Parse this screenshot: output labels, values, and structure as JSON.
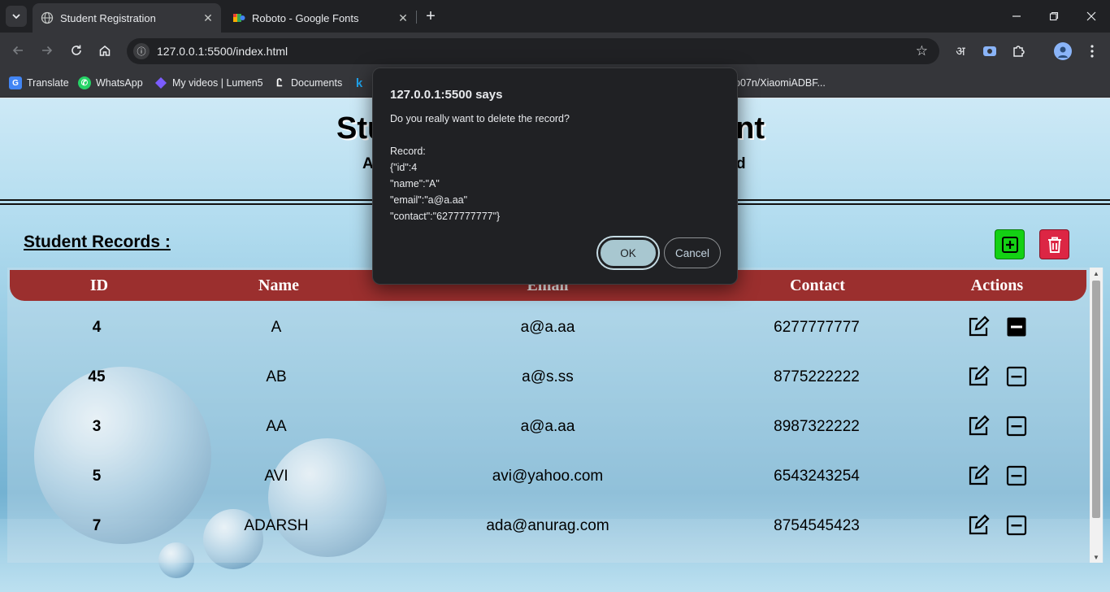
{
  "browser": {
    "tabs": [
      {
        "title": "Student Registration",
        "active": true,
        "icon": "globe-icon"
      },
      {
        "title": "Roboto - Google Fonts",
        "active": false,
        "icon": "google-fonts-icon"
      }
    ],
    "url": "127.0.0.1:5500/index.html",
    "bookmarks": [
      {
        "label": "Translate",
        "icon": "translate-icon",
        "color": "#4285f4"
      },
      {
        "label": "WhatsApp",
        "icon": "whatsapp-icon",
        "color": "#25d366"
      },
      {
        "label": "My videos | Lumen5",
        "icon": "lumen5-icon",
        "color": "#7b5cff"
      },
      {
        "label": "Documents",
        "icon": "documents-icon",
        "color": "#ffffff"
      },
      {
        "label": "",
        "icon": "k-icon",
        "color": "#1fa3ec"
      },
      {
        "label": "p07n/XiaomiADBF...",
        "icon": "",
        "color": ""
      }
    ],
    "extension_label": "अ"
  },
  "page": {
    "title_left": "Stu",
    "title_right": "ent",
    "subtitle_left": "A",
    "subtitle_right": "d",
    "records_title": "Student Records :",
    "columns": [
      "ID",
      "Name",
      "Email",
      "Contact",
      "Actions"
    ],
    "rows": [
      {
        "id": "4",
        "name": "A",
        "email": "a@a.aa",
        "contact": "6277777777"
      },
      {
        "id": "45",
        "name": "AB",
        "email": "a@s.ss",
        "contact": "8775222222"
      },
      {
        "id": "3",
        "name": "AA",
        "email": "a@a.aa",
        "contact": "8987322222"
      },
      {
        "id": "5",
        "name": "AVI",
        "email": "avi@yahoo.com",
        "contact": "6543243254"
      },
      {
        "id": "7",
        "name": "ADARSH",
        "email": "ada@anurag.com",
        "contact": "8754545423"
      }
    ],
    "colors": {
      "header": "#9b2f2e",
      "add": "#14d114",
      "delete": "#dc2644"
    }
  },
  "dialog": {
    "title": "127.0.0.1:5500 says",
    "message": "Do you really want to delete the record?",
    "record_label": "Record:",
    "record_lines": [
      "{\"id\":4",
      "\"name\":\"A\"",
      "\"email\":\"a@a.aa\"",
      "\"contact\":\"6277777777\"}"
    ],
    "ok_label": "OK",
    "cancel_label": "Cancel"
  }
}
